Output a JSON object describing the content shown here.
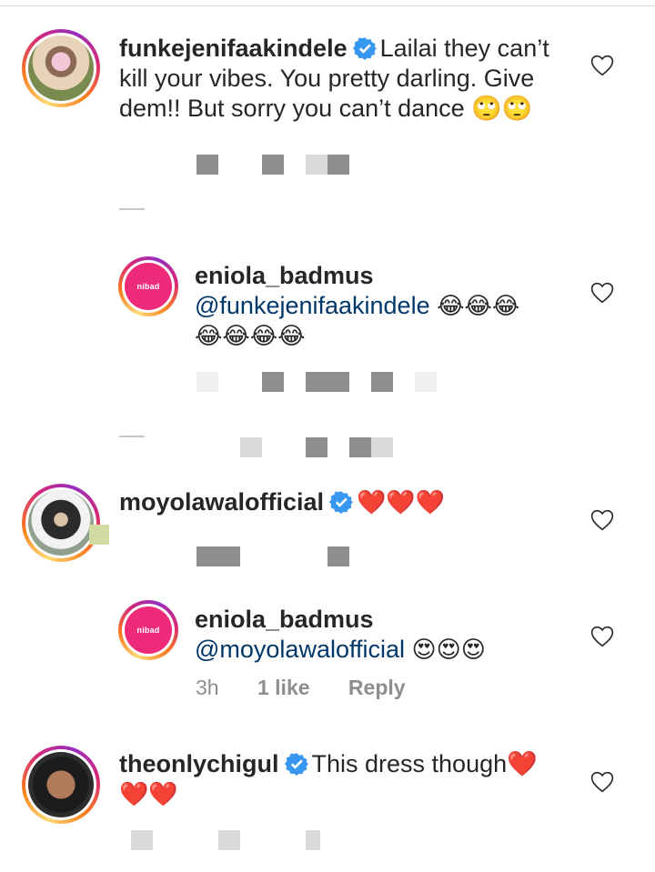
{
  "comments": [
    {
      "username": "funkejenifaakindele",
      "verified": true,
      "text": "Lailai they can’t kill your vibes. You pretty darling. Give dem!! But sorry you can’t dance 🙄🙄"
    },
    {
      "username": "eniola_badmus",
      "mention": "@funkejenifaakindele",
      "emojis": "😂😂😂",
      "emojis2": "😂😂😂😂",
      "avatar_text": "nibad"
    },
    {
      "username": "moyolawalofficial",
      "verified": true,
      "text": "❤️❤️❤️"
    },
    {
      "username": "eniola_badmus",
      "mention": "@moyolawalofficial",
      "emojis": "😍😍😍",
      "time": "3h",
      "likes": "1 like",
      "reply": "Reply",
      "avatar_text": "nibad"
    },
    {
      "username": "theonlychigul",
      "verified": true,
      "text": "This dress though❤️",
      "text2": "❤️❤️"
    }
  ],
  "icons": {
    "verified": "verified-badge-icon",
    "like": "heart-outline-icon"
  },
  "colors": {
    "text": "#262626",
    "mention": "#00376b",
    "meta": "#8e8e8e",
    "verified": "#3897f0"
  }
}
